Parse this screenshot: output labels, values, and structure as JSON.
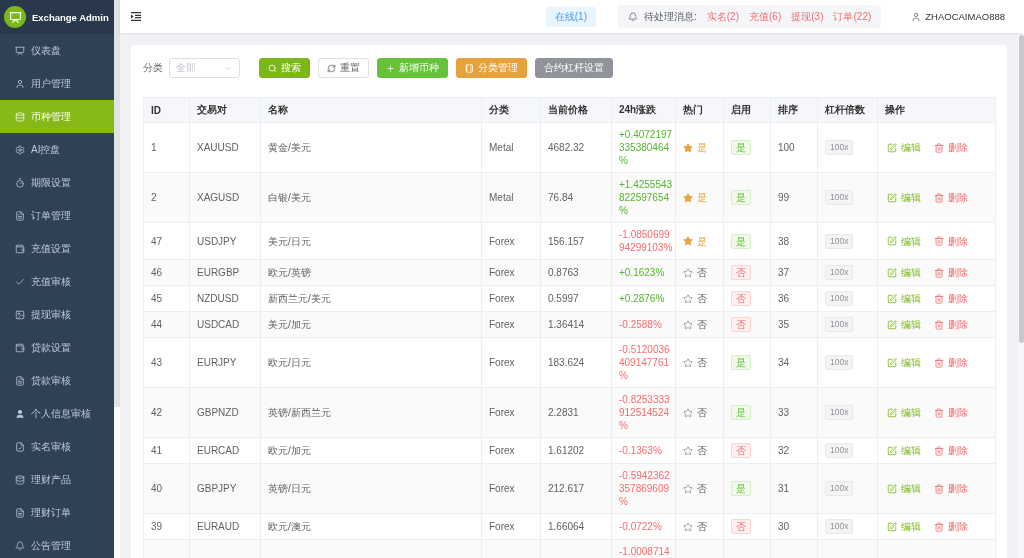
{
  "sidebar": {
    "brand": "Exchange Admin",
    "items": [
      {
        "label": "仪表盘",
        "kind": "presentation",
        "selected": false
      },
      {
        "label": "用户管理",
        "kind": "user",
        "selected": false
      },
      {
        "label": "币种管理",
        "kind": "database",
        "selected": true
      },
      {
        "label": "AI控盘",
        "kind": "gear",
        "selected": false
      },
      {
        "label": "期限设置",
        "kind": "stopwatch",
        "selected": false
      },
      {
        "label": "订单管理",
        "kind": "document",
        "selected": false
      },
      {
        "label": "充值设置",
        "kind": "wallet",
        "selected": false
      },
      {
        "label": "充值审核",
        "kind": "check",
        "selected": false
      },
      {
        "label": "提现审核",
        "kind": "picture",
        "selected": false
      },
      {
        "label": "贷款设置",
        "kind": "wallet",
        "selected": false
      },
      {
        "label": "贷款审核",
        "kind": "document",
        "selected": false
      },
      {
        "label": "个人信息审核",
        "kind": "person",
        "selected": false
      },
      {
        "label": "实名审核",
        "kind": "filecheck",
        "selected": false
      },
      {
        "label": "理财产品",
        "kind": "database",
        "selected": false
      },
      {
        "label": "理财订单",
        "kind": "document",
        "selected": false
      },
      {
        "label": "公告管理",
        "kind": "bell",
        "selected": false
      }
    ]
  },
  "topbar": {
    "online": "在线(1)",
    "pending_label": "待处理消息:",
    "pending": [
      "实名(2)",
      "充值(6)",
      "提现(3)",
      "订单(22)"
    ],
    "user": "ZHAOCAIMAO888"
  },
  "filter": {
    "label": "分类",
    "select": {
      "placeholder": "全部"
    },
    "buttons": [
      {
        "kind": "search",
        "label": "搜索"
      },
      {
        "kind": "reset",
        "label": "重置"
      },
      {
        "kind": "add",
        "label": "新增币种"
      },
      {
        "kind": "category",
        "label": "分类管理"
      },
      {
        "kind": "leverage",
        "label": "合约杠杆设置"
      }
    ]
  },
  "table": {
    "columns": [
      "ID",
      "交易对",
      "名称",
      "分类",
      "当前价格",
      "24h涨跌",
      "热门",
      "启用",
      "排序",
      "杠杆倍数",
      "操作"
    ],
    "rows": [
      {
        "id": "1",
        "pair": "XAUUSD",
        "name": "黄金/美元",
        "category": "Metal",
        "price": "4682.32",
        "change": "+0.4072197335380464%",
        "rising": true,
        "hot": true,
        "hot_label": "是",
        "enabled": true,
        "enabled_label": "是",
        "sort": "100",
        "leverage": "100x",
        "actions": [
          {
            "kind": "edit",
            "label": "编辑"
          },
          {
            "kind": "delete",
            "label": "删除"
          }
        ]
      },
      {
        "id": "2",
        "pair": "XAGUSD",
        "name": "白银/美元",
        "category": "Metal",
        "price": "76.84",
        "change": "+1.4255543822597654%",
        "rising": true,
        "hot": true,
        "hot_label": "是",
        "enabled": true,
        "enabled_label": "是",
        "sort": "99",
        "leverage": "100x",
        "actions": [
          {
            "kind": "edit",
            "label": "编辑"
          },
          {
            "kind": "delete",
            "label": "删除"
          }
        ]
      },
      {
        "id": "47",
        "pair": "USDJPY",
        "name": "美元/日元",
        "category": "Forex",
        "price": "156.157",
        "change": "-1.085069994299103%",
        "rising": false,
        "hot": true,
        "hot_label": "是",
        "enabled": true,
        "enabled_label": "是",
        "sort": "38",
        "leverage": "100x",
        "actions": [
          {
            "kind": "edit",
            "label": "编辑"
          },
          {
            "kind": "delete",
            "label": "删除"
          }
        ]
      },
      {
        "id": "46",
        "pair": "EURGBP",
        "name": "欧元/英镑",
        "category": "Forex",
        "price": "0.8763",
        "change": "+0.1623%",
        "rising": true,
        "hot": false,
        "hot_label": "否",
        "enabled": false,
        "enabled_label": "否",
        "sort": "37",
        "leverage": "100x",
        "actions": [
          {
            "kind": "edit",
            "label": "编辑"
          },
          {
            "kind": "delete",
            "label": "删除"
          }
        ]
      },
      {
        "id": "45",
        "pair": "NZDUSD",
        "name": "新西兰元/美元",
        "category": "Forex",
        "price": "0.5997",
        "change": "+0.2876%",
        "rising": true,
        "hot": false,
        "hot_label": "否",
        "enabled": false,
        "enabled_label": "否",
        "sort": "36",
        "leverage": "100x",
        "actions": [
          {
            "kind": "edit",
            "label": "编辑"
          },
          {
            "kind": "delete",
            "label": "删除"
          }
        ]
      },
      {
        "id": "44",
        "pair": "USDCAD",
        "name": "美元/加元",
        "category": "Forex",
        "price": "1.36414",
        "change": "-0.2588%",
        "rising": false,
        "hot": false,
        "hot_label": "否",
        "enabled": false,
        "enabled_label": "否",
        "sort": "35",
        "leverage": "100x",
        "actions": [
          {
            "kind": "edit",
            "label": "编辑"
          },
          {
            "kind": "delete",
            "label": "删除"
          }
        ]
      },
      {
        "id": "43",
        "pair": "EURJPY",
        "name": "欧元/日元",
        "category": "Forex",
        "price": "183.624",
        "change": "-0.5120036409147761%",
        "rising": false,
        "hot": false,
        "hot_label": "否",
        "enabled": true,
        "enabled_label": "是",
        "sort": "34",
        "leverage": "100x",
        "actions": [
          {
            "kind": "edit",
            "label": "编辑"
          },
          {
            "kind": "delete",
            "label": "删除"
          }
        ]
      },
      {
        "id": "42",
        "pair": "GBPNZD",
        "name": "英镑/新西兰元",
        "category": "Forex",
        "price": "2.2831",
        "change": "-0.8253333912514524%",
        "rising": false,
        "hot": false,
        "hot_label": "否",
        "enabled": true,
        "enabled_label": "是",
        "sort": "33",
        "leverage": "100x",
        "actions": [
          {
            "kind": "edit",
            "label": "编辑"
          },
          {
            "kind": "delete",
            "label": "删除"
          }
        ]
      },
      {
        "id": "41",
        "pair": "EURCAD",
        "name": "欧元/加元",
        "category": "Forex",
        "price": "1.61202",
        "change": "-0.1363%",
        "rising": false,
        "hot": false,
        "hot_label": "否",
        "enabled": false,
        "enabled_label": "否",
        "sort": "32",
        "leverage": "100x",
        "actions": [
          {
            "kind": "edit",
            "label": "编辑"
          },
          {
            "kind": "delete",
            "label": "删除"
          }
        ]
      },
      {
        "id": "40",
        "pair": "GBPJPY",
        "name": "英镑/日元",
        "category": "Forex",
        "price": "212.617",
        "change": "-0.5942362357869609%",
        "rising": false,
        "hot": false,
        "hot_label": "否",
        "enabled": true,
        "enabled_label": "是",
        "sort": "31",
        "leverage": "100x",
        "actions": [
          {
            "kind": "edit",
            "label": "编辑"
          },
          {
            "kind": "delete",
            "label": "删除"
          }
        ]
      },
      {
        "id": "39",
        "pair": "EURAUD",
        "name": "欧元/澳元",
        "category": "Forex",
        "price": "1.66064",
        "change": "-0.0722%",
        "rising": false,
        "hot": false,
        "hot_label": "否",
        "enabled": false,
        "enabled_label": "否",
        "sort": "30",
        "leverage": "100x",
        "actions": [
          {
            "kind": "edit",
            "label": "编辑"
          },
          {
            "kind": "delete",
            "label": "删除"
          }
        ]
      },
      {
        "change": "-1.0008714",
        "rising": false
      }
    ]
  }
}
